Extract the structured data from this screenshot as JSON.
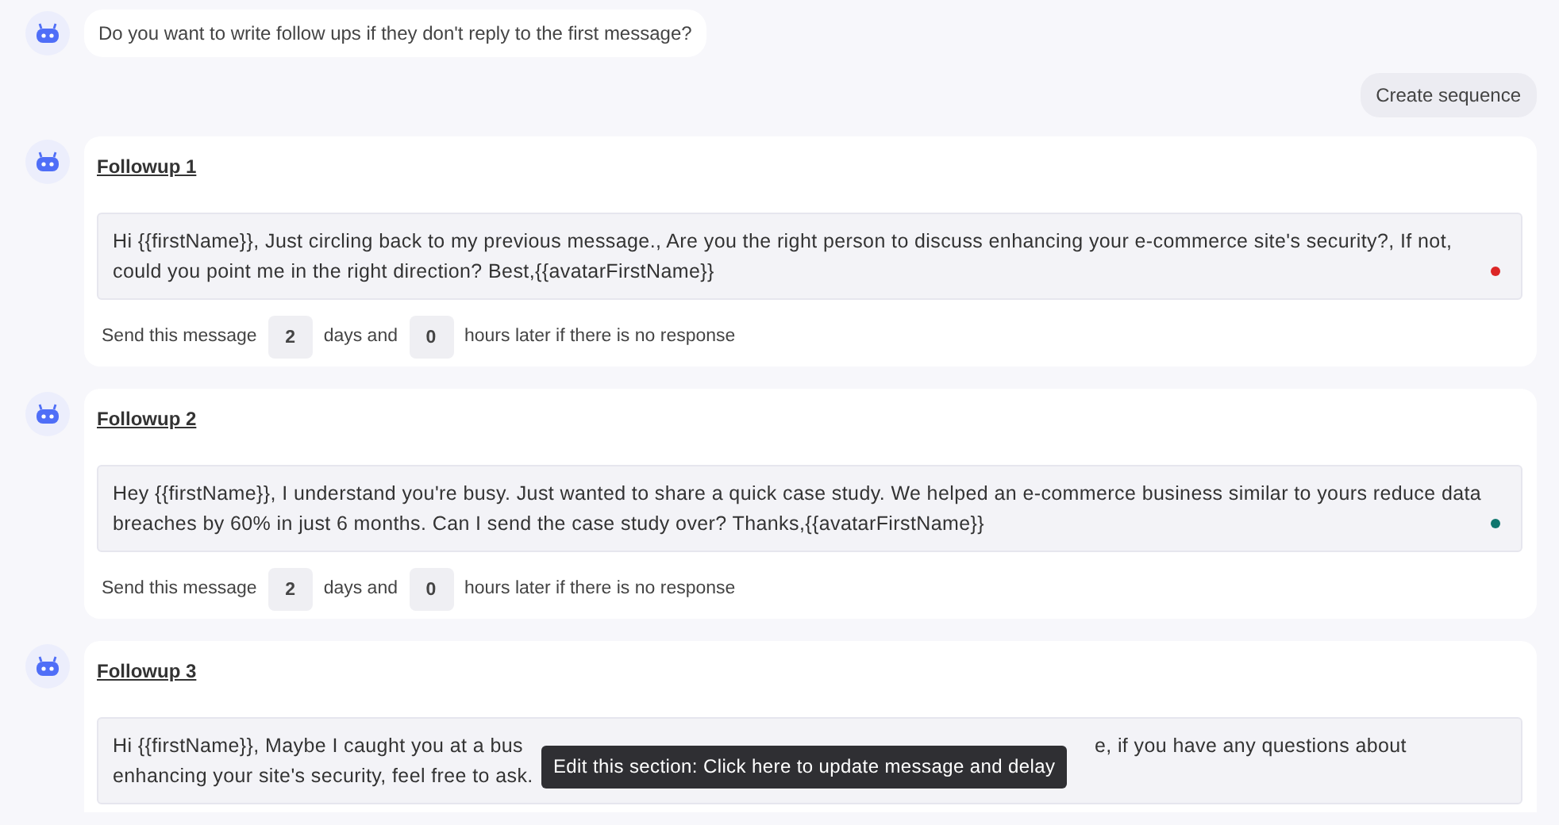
{
  "question": "Do you want to write follow ups if they don't reply to the first message?",
  "reply_button": "Create sequence",
  "followups": [
    {
      "title": "Followup 1",
      "message": "Hi {{firstName}}, Just circling back to my previous message., Are you the right person to discuss enhancing your e-commerce site's security?, If not, could you point me in the right direction? Best,{{avatarFirstName}}",
      "color": "#dc2626",
      "prefix": "Send this message",
      "days": "2",
      "days_label": "days and",
      "hours": "0",
      "suffix": "hours later if there is no response"
    },
    {
      "title": "Followup 2",
      "message": "Hey {{firstName}}, I understand you're busy. Just wanted to share a quick case study. We helped an e-commerce business similar to yours reduce data breaches by 60% in just 6 months. Can I send the case study over? Thanks,{{avatarFirstName}}",
      "color": "#0f766e",
      "prefix": "Send this message",
      "days": "2",
      "days_label": "days and",
      "hours": "0",
      "suffix": "hours later if there is no response"
    },
    {
      "title": "Followup 3",
      "message_lines": [
        {
          "before": "Hi {{firstName}}, Maybe I caught you at a bus",
          "after": "e, if you have any questions about"
        },
        {
          "before": "enhancing your site's security, feel free to ask."
        }
      ]
    }
  ],
  "tooltip": "Edit this section: Click here to update message and delay"
}
